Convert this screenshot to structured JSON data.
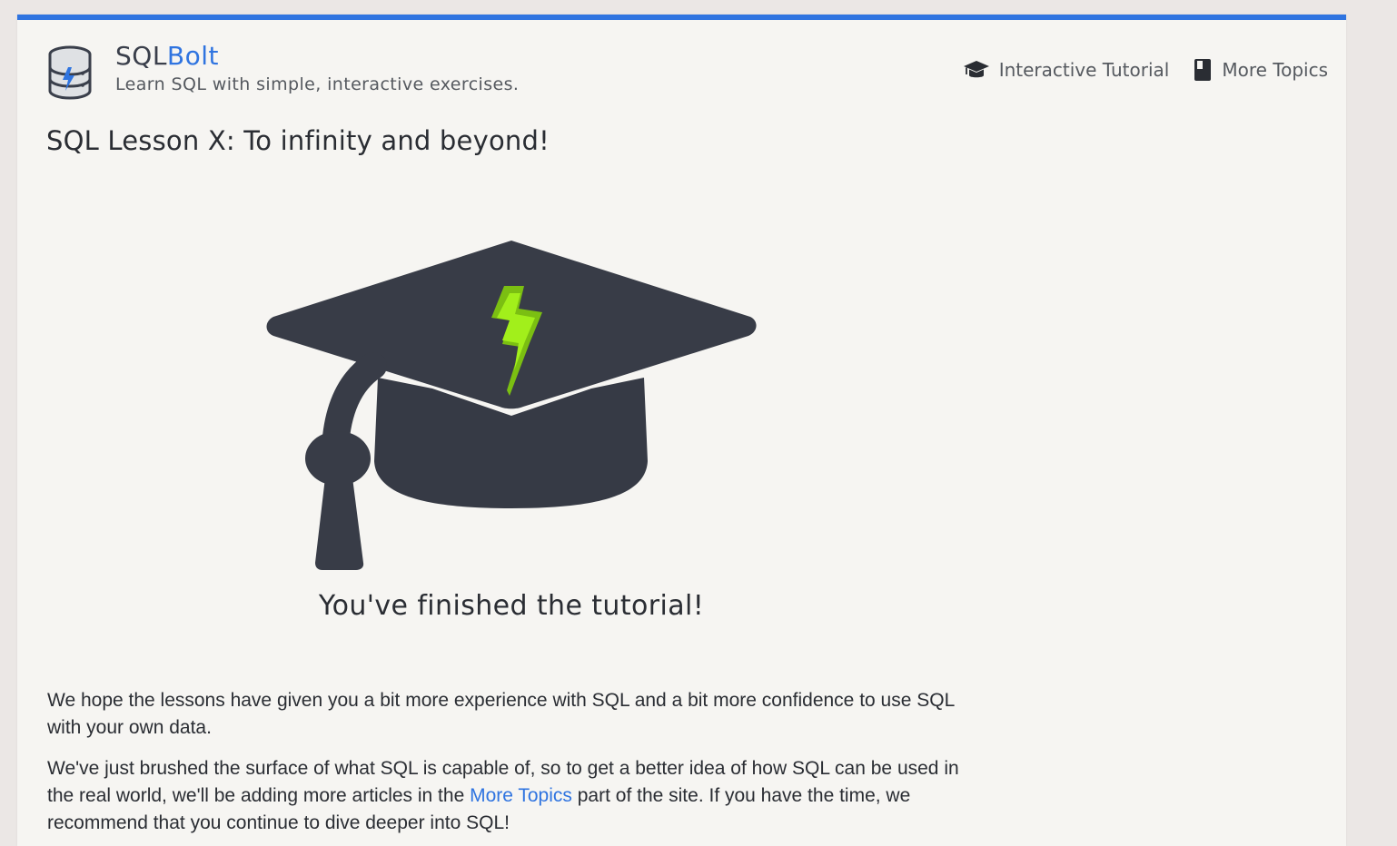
{
  "header": {
    "brand_main": "SQL",
    "brand_accent": "Bolt",
    "tagline": "Learn SQL with simple, interactive exercises.",
    "logo_icon": "database-bolt-icon"
  },
  "nav": {
    "items": [
      {
        "label": "Interactive Tutorial",
        "icon": "graduation-cap-icon"
      },
      {
        "label": "More Topics",
        "icon": "book-icon"
      }
    ]
  },
  "lesson": {
    "title": "SQL Lesson X: To infinity and beyond!",
    "hero_icon": "graduation-cap-bolt-illustration",
    "finished_text": "You've finished the tutorial!",
    "paragraph_1": "We hope the lessons have given you a bit more experience with SQL and a bit more confidence to use SQL with your own data.",
    "paragraph_2_before": "We've just brushed the surface of what SQL is capable of, so to get a better idea of how SQL can be used in the real world, we'll be adding more articles in the ",
    "paragraph_2_link": "More Topics",
    "paragraph_2_after": " part of the site. If you have the time, we recommend that you continue to dive deeper into SQL!"
  },
  "colors": {
    "accent": "#2f74e0",
    "bolt_green": "#8ee000",
    "cap_dark": "#383c47",
    "page_bg": "#f6f5f2"
  }
}
